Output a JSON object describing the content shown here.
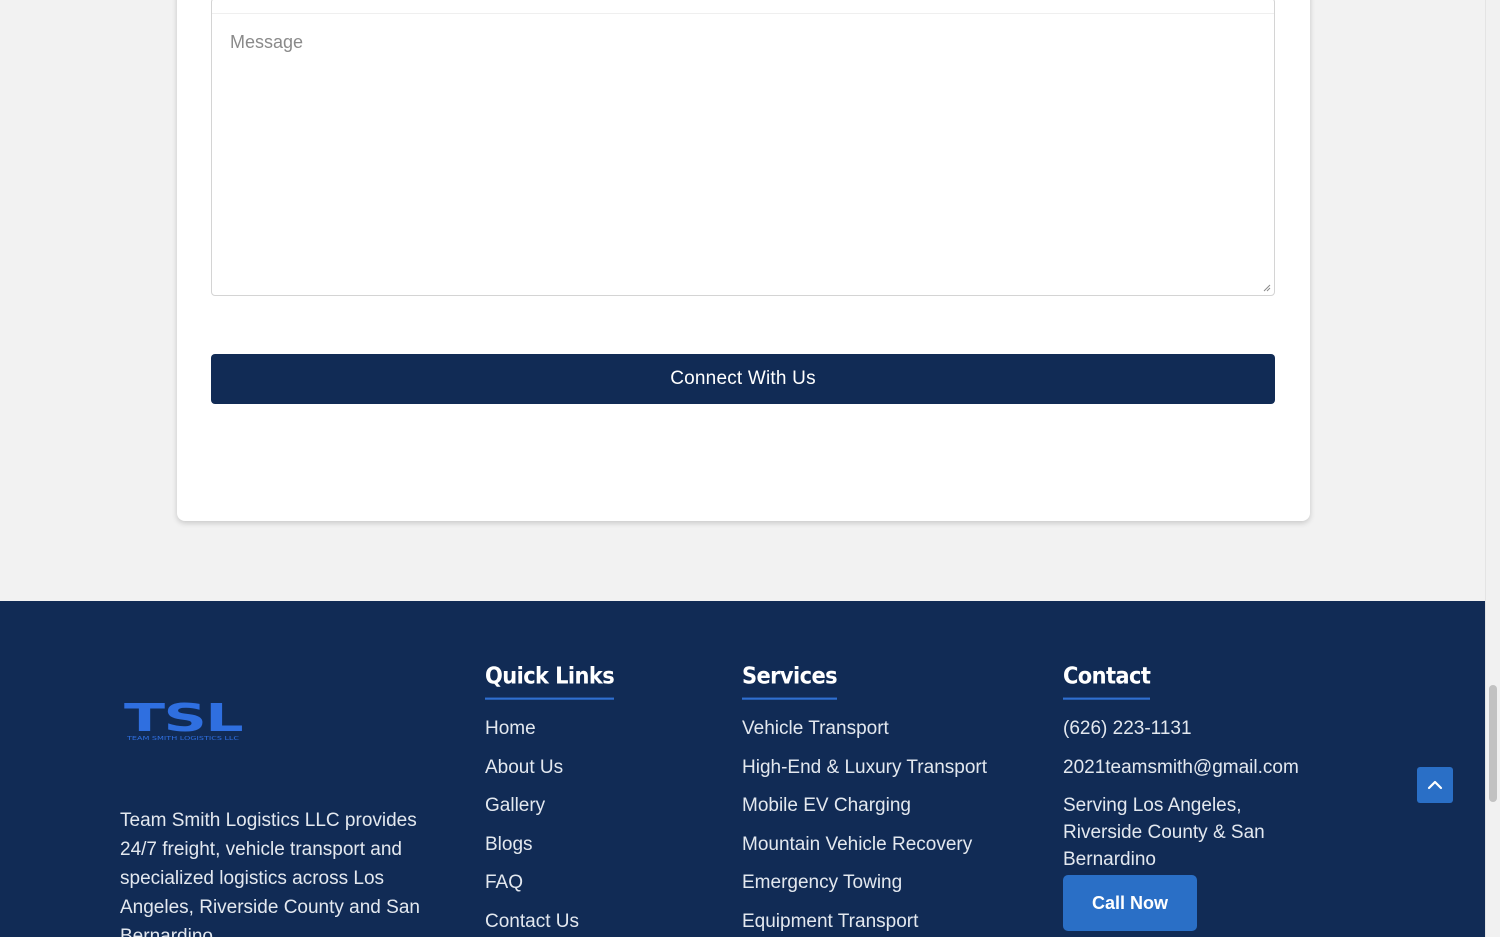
{
  "form": {
    "message_placeholder": "Message",
    "submit_label": "Connect With Us"
  },
  "footer": {
    "logo": {
      "text": "TSL",
      "subtext": "TEAM SMITH LOGISTICS LLC"
    },
    "about": "Team Smith Logistics LLC provides 24/7 freight, vehicle transport and specialized logistics across Los Angeles, Riverside County and San Bernardino.",
    "quick_links": {
      "title": "Quick Links",
      "items": [
        "Home",
        "About Us",
        "Gallery",
        "Blogs",
        "FAQ",
        "Contact Us"
      ]
    },
    "services": {
      "title": "Services",
      "items": [
        "Vehicle Transport",
        "High-End & Luxury Transport",
        "Mobile EV Charging",
        "Mountain Vehicle Recovery",
        "Emergency Towing",
        "Equipment Transport"
      ]
    },
    "contact": {
      "title": "Contact",
      "phone": "(626) 223-1131",
      "email": "2021teamsmith@gmail.com",
      "area": "Serving Los Angeles, Riverside County & San Bernardino",
      "call_label": "Call Now"
    }
  },
  "colors": {
    "footer_bg": "#112b55",
    "accent_blue": "#2a6fc6",
    "page_bg": "#f2f2f2"
  },
  "icons": [
    "resize-grip-icon",
    "chevron-up-icon"
  ]
}
